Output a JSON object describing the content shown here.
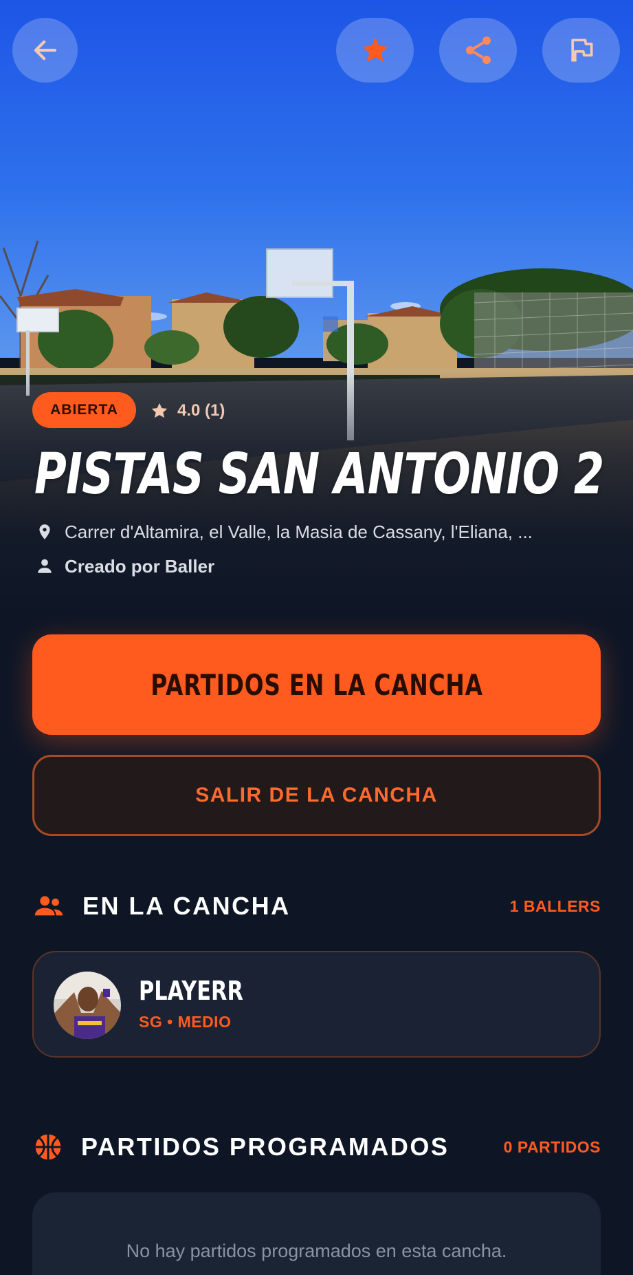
{
  "header": {
    "back_icon": "arrow-left-icon",
    "favorite_icon": "star-icon",
    "share_icon": "share-icon",
    "report_icon": "flag-icon"
  },
  "court": {
    "status": "ABIERTA",
    "rating": "4.0 (1)",
    "name": "PISTAS SAN ANTONIO 2",
    "address": "Carrer d'Altamira, el Valle, la Masia de Cassany, l'Eliana, ...",
    "creator": "Creado por Baller"
  },
  "actions": {
    "primary": "PARTIDOS EN LA CANCHA",
    "secondary": "SALIR DE LA CANCHA"
  },
  "on_court": {
    "title": "EN LA CANCHA",
    "count": "1 BALLERS",
    "players": [
      {
        "name": "PLAYERR",
        "meta": "SG • MEDIO"
      }
    ]
  },
  "scheduled": {
    "title": "PARTIDOS PROGRAMADOS",
    "count": "0 PARTIDOS",
    "empty": "No hay partidos programados en esta cancha."
  },
  "colors": {
    "accent": "#ff5b1f",
    "background": "#0e1626",
    "card": "#1a2233"
  }
}
